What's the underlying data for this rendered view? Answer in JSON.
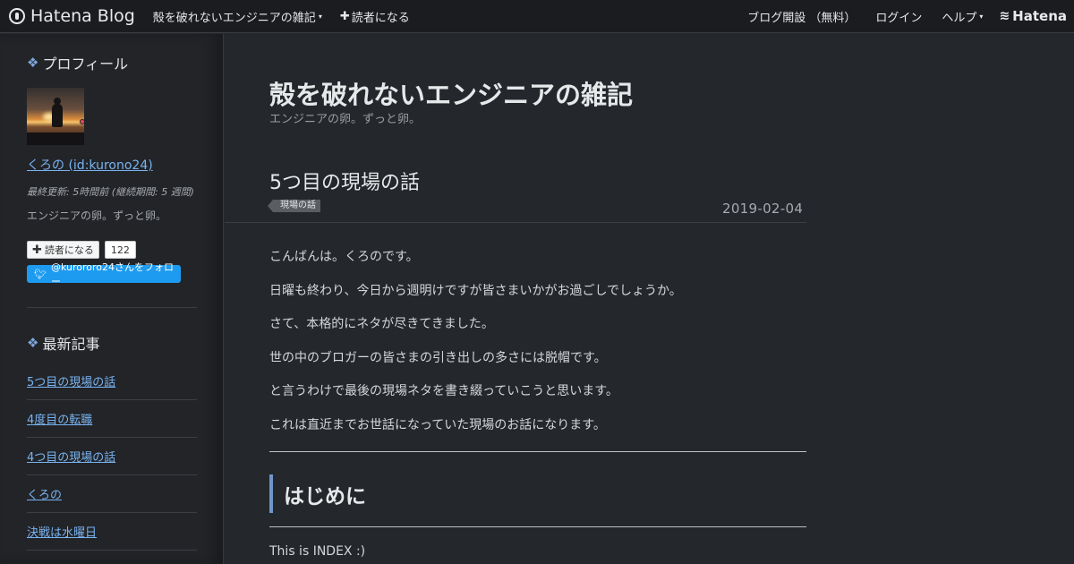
{
  "topbar": {
    "brand": "Hatena Blog",
    "blog_menu": "殻を破れないエンジニアの雑記",
    "subscribe": "読者になる",
    "open_blog": "ブログ開設 （無料）",
    "login": "ログイン",
    "help": "ヘルプ",
    "hatena": "Hatena"
  },
  "sidebar": {
    "profile_heading": "プロフィール",
    "user_link": "くろの (id:kurono24)",
    "updated": "最終更新: 5時間前 (継続期間: 5 週間)",
    "description": "エンジニアの卵。ずっと卵。",
    "reader_button": "読者になる",
    "reader_count": "122",
    "twitter_button": "@kurororo24さんをフォロー",
    "recent_heading": "最新記事",
    "recent_items": [
      "5つ目の現場の話",
      "4度目の転職",
      "4つ目の現場の話",
      "くろの",
      "決戦は水曜日"
    ]
  },
  "blog": {
    "title": "殻を破れないエンジニアの雑記",
    "subtitle": "エンジニアの卵。ずっと卵。"
  },
  "entry": {
    "title": "5つ目の現場の話",
    "category": "現場の話",
    "date": "2019-02-04",
    "paragraphs": [
      "こんばんは。くろのです。",
      "日曜も終わり、今日から週明けですが皆さまいかがお過ごしでしょうか。",
      "さて、本格的にネタが尽きてきました。",
      "世の中のブロガーの皆さまの引き出しの多さには脱帽です。",
      "と言うわけで最後の現場ネタを書き綴っていこうと思います。",
      "これは直近までお世話になっていた現場のお話になります。"
    ],
    "section_heading": "はじめに",
    "index_text": "This is INDEX :)"
  }
}
